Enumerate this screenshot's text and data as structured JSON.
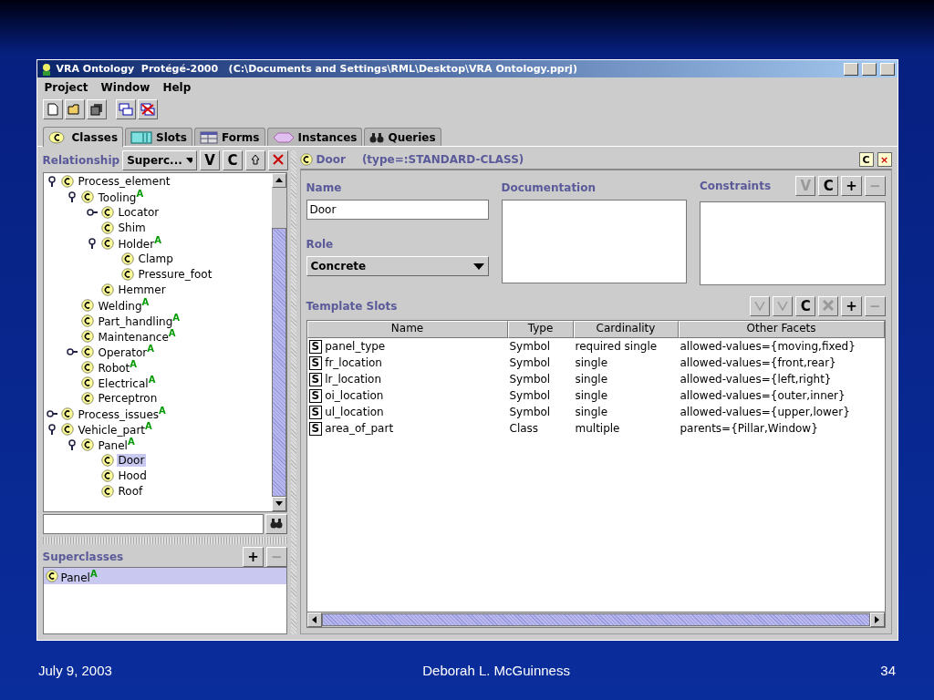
{
  "window": {
    "title": "VRA Ontology  Protégé-2000   (C:\\Documents and Settings\\RML\\Desktop\\VRA Ontology.pprj)"
  },
  "menu": [
    "Project",
    "Window",
    "Help"
  ],
  "tabs": [
    {
      "label": "Classes",
      "kind": "classes",
      "selected": true
    },
    {
      "label": "Slots",
      "kind": "slots",
      "selected": false
    },
    {
      "label": "Forms",
      "kind": "forms",
      "selected": false
    },
    {
      "label": "Instances",
      "kind": "instances",
      "selected": false
    },
    {
      "label": "Queries",
      "kind": "queries",
      "selected": false
    }
  ],
  "class_browser": {
    "relationship_label": "Relationship",
    "relationship_value": "Superc...",
    "buttons": [
      "V",
      "C"
    ],
    "tree": [
      {
        "name": "Process_element",
        "expanded": true,
        "selected": false,
        "children": [
          {
            "name": "Tooling",
            "badge": "A",
            "expanded": true,
            "selected": false,
            "children": [
              {
                "name": "Locator",
                "expanded": false,
                "selected": false
              },
              {
                "name": "Shim",
                "selected": false
              },
              {
                "name": "Holder",
                "badge": "A",
                "expanded": true,
                "selected": false,
                "children": [
                  {
                    "name": "Clamp",
                    "selected": false
                  },
                  {
                    "name": "Pressure_foot",
                    "selected": false
                  }
                ]
              },
              {
                "name": "Hemmer",
                "selected": false
              }
            ]
          },
          {
            "name": "Welding",
            "badge": "A",
            "selected": false
          },
          {
            "name": "Part_handling",
            "badge": "A",
            "selected": false
          },
          {
            "name": "Maintenance",
            "badge": "A",
            "selected": false
          },
          {
            "name": "Operator",
            "badge": "A",
            "expanded": false,
            "selected": false
          },
          {
            "name": "Robot",
            "badge": "A",
            "selected": false
          },
          {
            "name": "Electrical",
            "badge": "A",
            "selected": false
          },
          {
            "name": "Perceptron",
            "selected": false
          }
        ]
      },
      {
        "name": "Process_issues",
        "badge": "A",
        "expanded": false,
        "selected": false
      },
      {
        "name": "Vehicle_part",
        "badge": "A",
        "expanded": true,
        "selected": false,
        "children": [
          {
            "name": "Panel",
            "badge": "A",
            "expanded": true,
            "selected": false,
            "children": [
              {
                "name": "Door",
                "selected": true
              },
              {
                "name": "Hood",
                "selected": false
              },
              {
                "name": "Roof",
                "selected": false
              }
            ]
          }
        ]
      }
    ],
    "superclasses": {
      "title": "Superclasses",
      "buttons": [
        "+",
        "−"
      ],
      "items": [
        {
          "name": "Panel",
          "badge": "A",
          "selected": true
        }
      ]
    }
  },
  "class_form": {
    "name_header": "Door",
    "type_text": "(type=:STANDARD-CLASS)",
    "header_buttons": [
      "C",
      "×"
    ],
    "name_label": "Name",
    "name_value": "Door",
    "documentation_label": "Documentation",
    "constraints_label": "Constraints",
    "constraint_buttons": [
      {
        "label": "V",
        "disabled": true
      },
      {
        "label": "C",
        "disabled": false
      },
      {
        "label": "+",
        "disabled": false
      },
      {
        "label": "−",
        "disabled": true
      }
    ],
    "role_label": "Role",
    "role_value": "Concrete",
    "template_slots": {
      "title": "Template Slots",
      "buttons": [
        {
          "label": "C",
          "disabled": false
        },
        {
          "label": "+",
          "disabled": false
        },
        {
          "label": "−",
          "disabled": true
        }
      ],
      "columns": [
        "Name",
        "Type",
        "Cardinality",
        "Other Facets"
      ],
      "rows": [
        {
          "marker": "S",
          "name": "panel_type",
          "type": "Symbol",
          "cardinality": "required single",
          "facets": "allowed-values={moving,fixed}"
        },
        {
          "marker": "S",
          "name": "fr_location",
          "type": "Symbol",
          "cardinality": "single",
          "facets": "allowed-values={front,rear}"
        },
        {
          "marker": "S",
          "name": "lr_location",
          "type": "Symbol",
          "cardinality": "single",
          "facets": "allowed-values={left,right}"
        },
        {
          "marker": "S",
          "name": "oi_location",
          "type": "Symbol",
          "cardinality": "single",
          "facets": "allowed-values={outer,inner}"
        },
        {
          "marker": "S",
          "name": "ul_location",
          "type": "Symbol",
          "cardinality": "single",
          "facets": "allowed-values={upper,lower}"
        },
        {
          "marker": "S",
          "name": "area_of_part",
          "type": "Class",
          "cardinality": "multiple",
          "facets": "parents={Pillar,Window}"
        }
      ]
    }
  },
  "footer": {
    "date": "July 9, 2003",
    "author": "Deborah L. McGuinness",
    "page": "34"
  }
}
